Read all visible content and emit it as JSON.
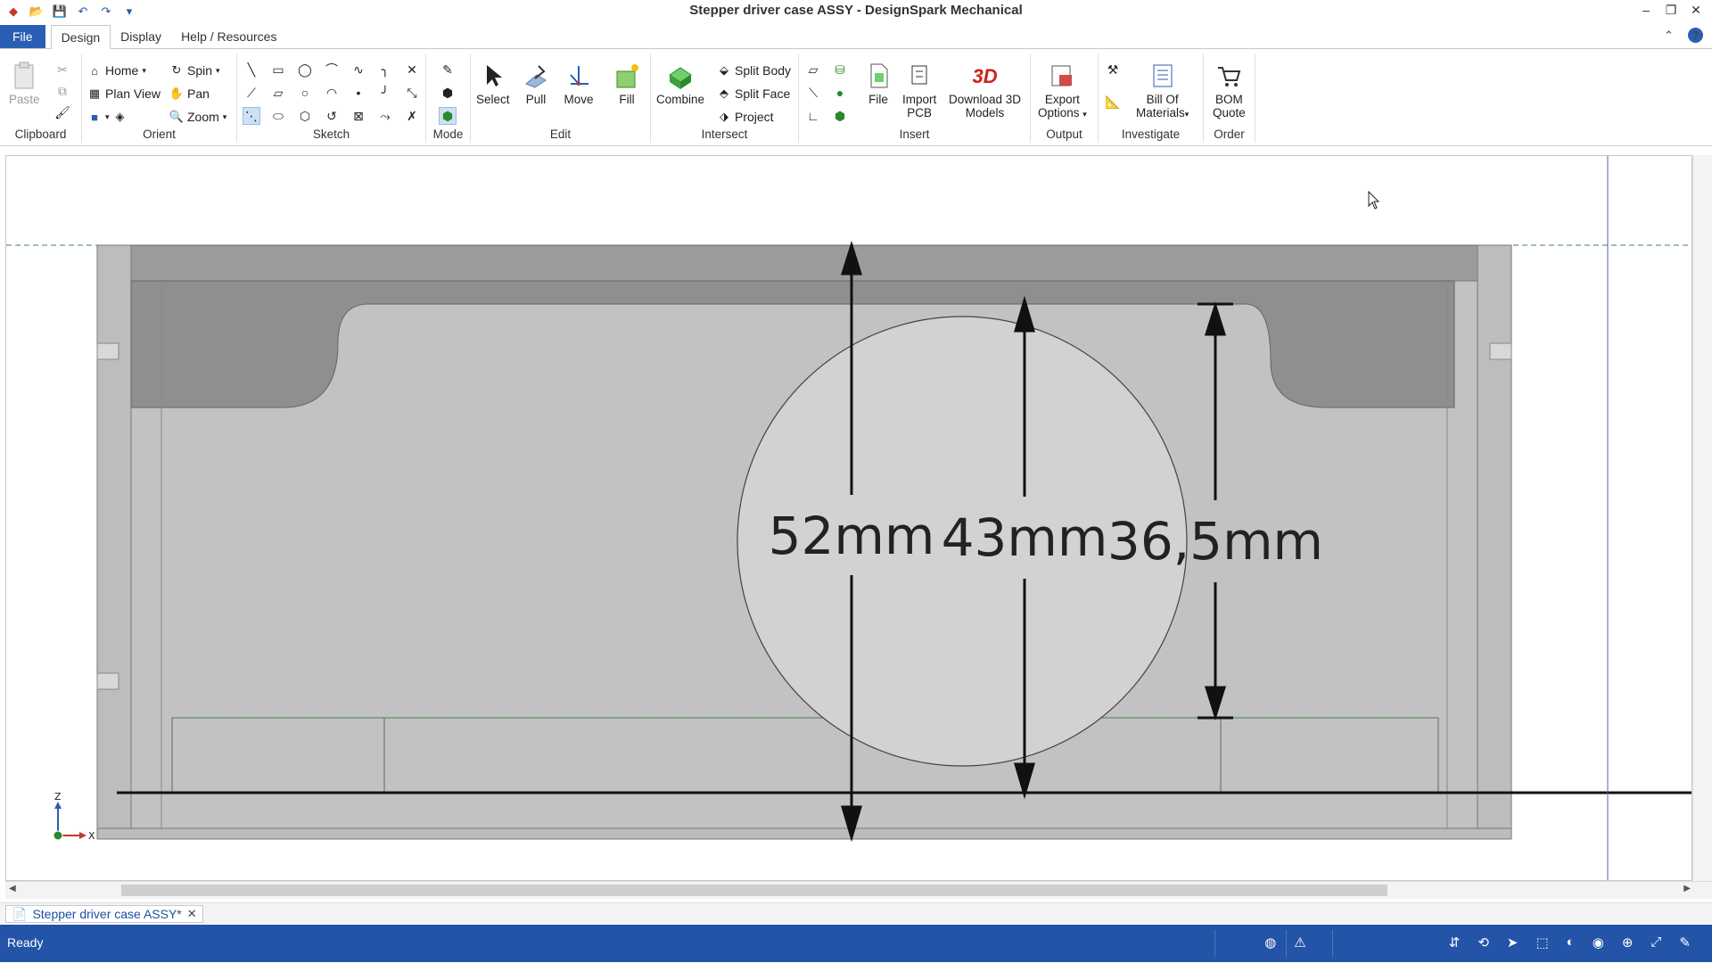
{
  "window": {
    "title": "Stepper driver case ASSY - DesignSpark Mechanical"
  },
  "ribbon_tabs": [
    "File",
    "Design",
    "Display",
    "Help / Resources"
  ],
  "groups": {
    "clipboard": {
      "label": "Clipboard",
      "paste": "Paste"
    },
    "orient": {
      "label": "Orient",
      "home": "Home",
      "plan_view": "Plan View",
      "spin": "Spin",
      "pan": "Pan",
      "zoom": "Zoom"
    },
    "sketch": {
      "label": "Sketch"
    },
    "mode": {
      "label": "Mode"
    },
    "edit": {
      "label": "Edit",
      "select": "Select",
      "pull": "Pull",
      "move": "Move",
      "fill": "Fill"
    },
    "intersect": {
      "label": "Intersect",
      "combine": "Combine",
      "split_body": "Split Body",
      "split_face": "Split Face",
      "project": "Project"
    },
    "insert": {
      "label": "Insert",
      "file": "File",
      "import_pcb_1": "Import",
      "import_pcb_2": "PCB",
      "download_1": "Download 3D",
      "download_2": "Models",
      "badge_3d": "3D"
    },
    "output": {
      "label": "Output",
      "export_1": "Export",
      "export_2": "Options"
    },
    "investigate": {
      "label": "Investigate",
      "bom_1": "Bill Of",
      "bom_2": "Materials"
    },
    "order": {
      "label": "Order",
      "quote_1": "BOM",
      "quote_2": "Quote"
    }
  },
  "viewport": {
    "dimensions": [
      "52mm",
      "43mm",
      "36,5mm"
    ],
    "axes": {
      "z": "Z",
      "x": "X"
    }
  },
  "document_tab": "Stepper driver case ASSY*",
  "status": {
    "text": "Ready"
  },
  "colors": {
    "accent": "#2354a8",
    "file_tab": "#2a5eb4",
    "model_face": "#c4c4c4",
    "model_dark": "#9a9a9a"
  }
}
